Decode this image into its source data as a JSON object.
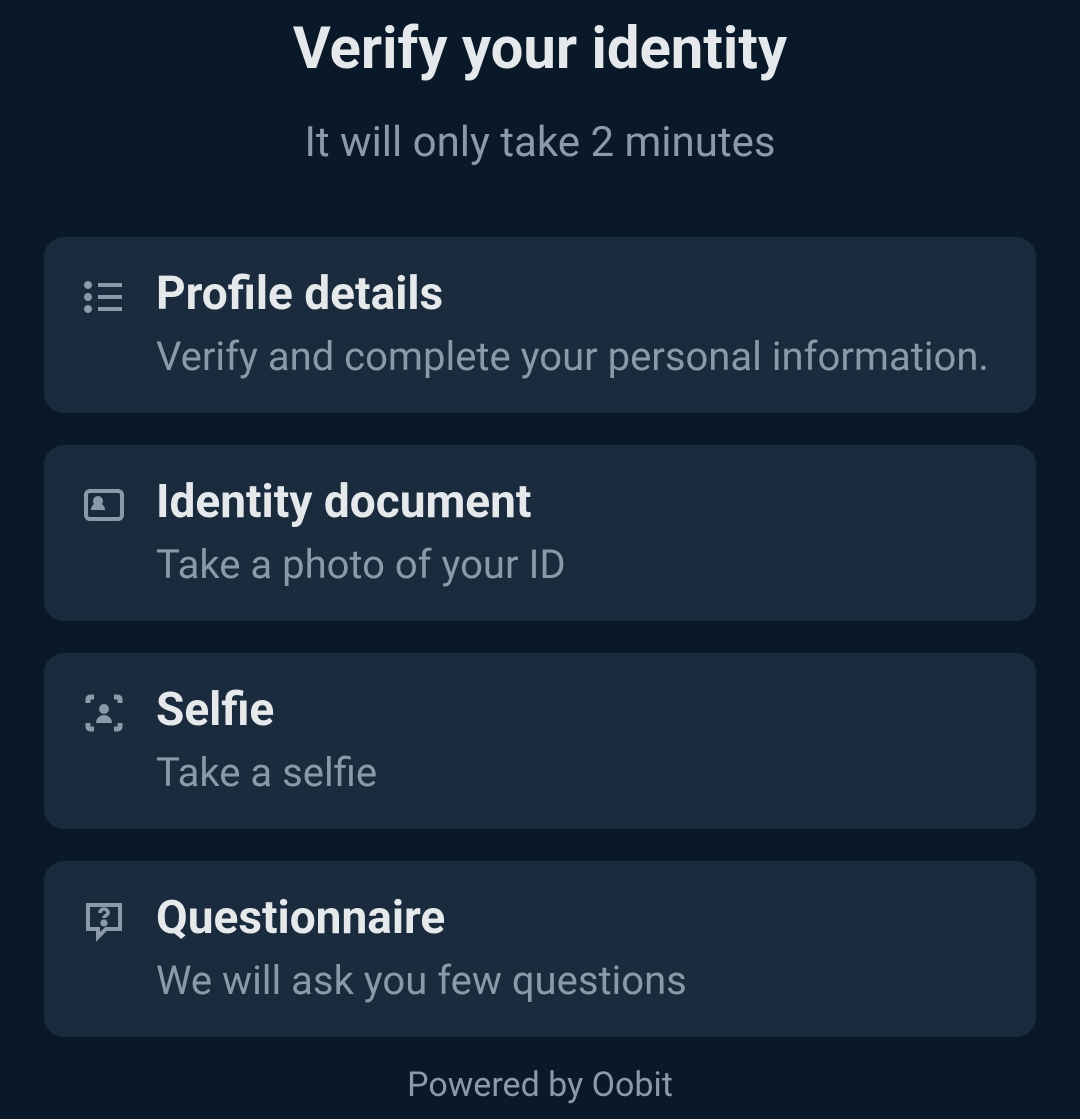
{
  "header": {
    "title": "Verify your identity",
    "subtitle": "It will only take 2 minutes"
  },
  "steps": [
    {
      "icon": "list-icon",
      "title": "Profile details",
      "description": "Verify and complete your personal information."
    },
    {
      "icon": "id-card-icon",
      "title": "Identity document",
      "description": "Take a photo of your ID"
    },
    {
      "icon": "selfie-icon",
      "title": "Selfie",
      "description": "Take a selfie"
    },
    {
      "icon": "question-icon",
      "title": "Questionnaire",
      "description": "We will ask you few questions"
    }
  ],
  "footer": {
    "text": "Powered by Oobit"
  }
}
